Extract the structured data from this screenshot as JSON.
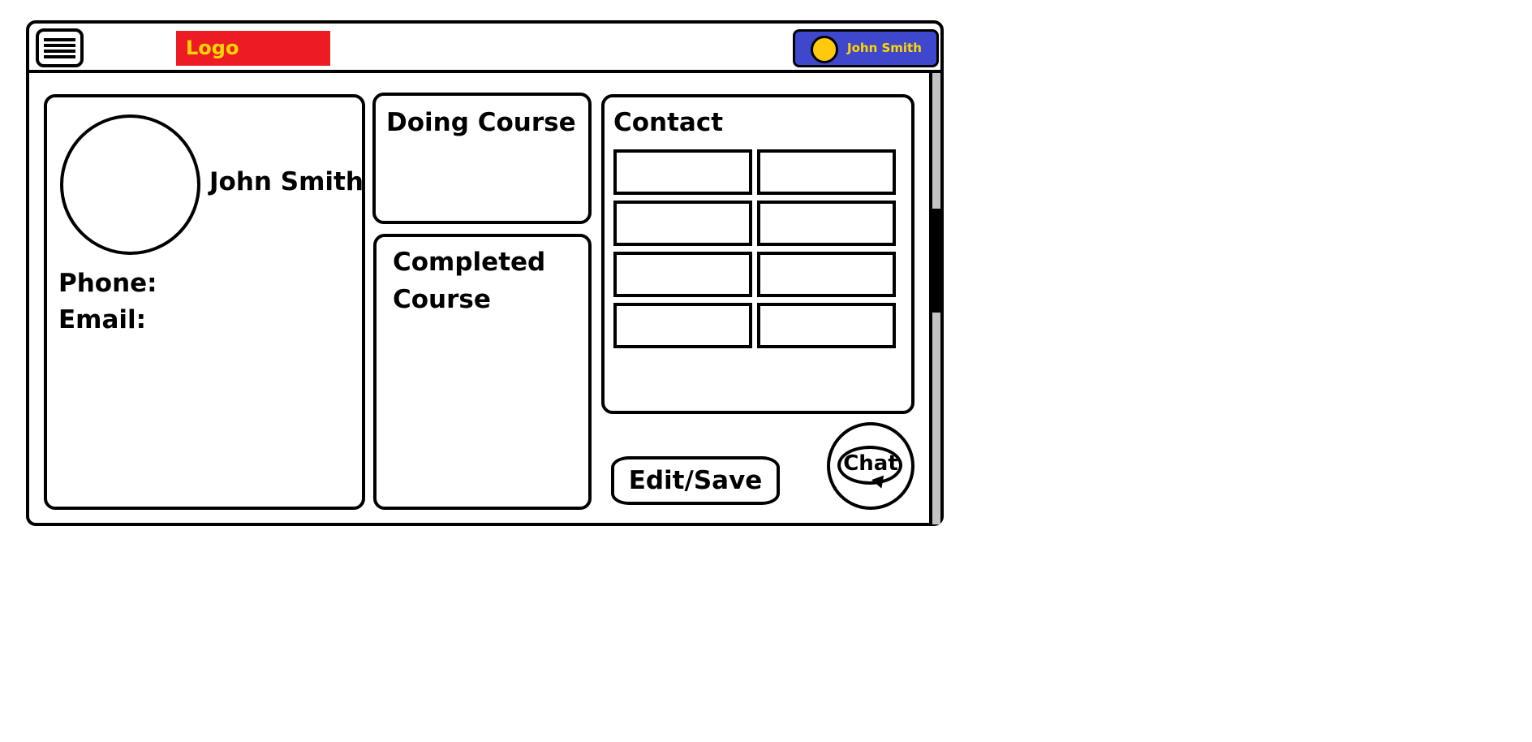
{
  "header": {
    "menu_icon": "hamburger-menu-icon",
    "logo_text": "Logo",
    "user": {
      "name": "John Smith",
      "avatar_color": "#ffc90e",
      "chip_color": "#3f48cc"
    }
  },
  "colors": {
    "logo_bg": "#ed1c24",
    "logo_text": "#ffd700",
    "scrollbar_track": "#c3c3c3"
  },
  "profile": {
    "name": "John Smith",
    "phone_label": "Phone:",
    "email_label": "Email:"
  },
  "courses": {
    "doing_title": "Doing Course",
    "completed_title_line1": "Completed",
    "completed_title_line2": "Course"
  },
  "contact": {
    "title": "Contact",
    "fields": [
      "",
      "",
      "",
      "",
      "",
      "",
      "",
      ""
    ]
  },
  "actions": {
    "edit_save_label": "Edit/Save",
    "chat_label": "Chat",
    "chat_icon": "speech-bubble-icon"
  }
}
